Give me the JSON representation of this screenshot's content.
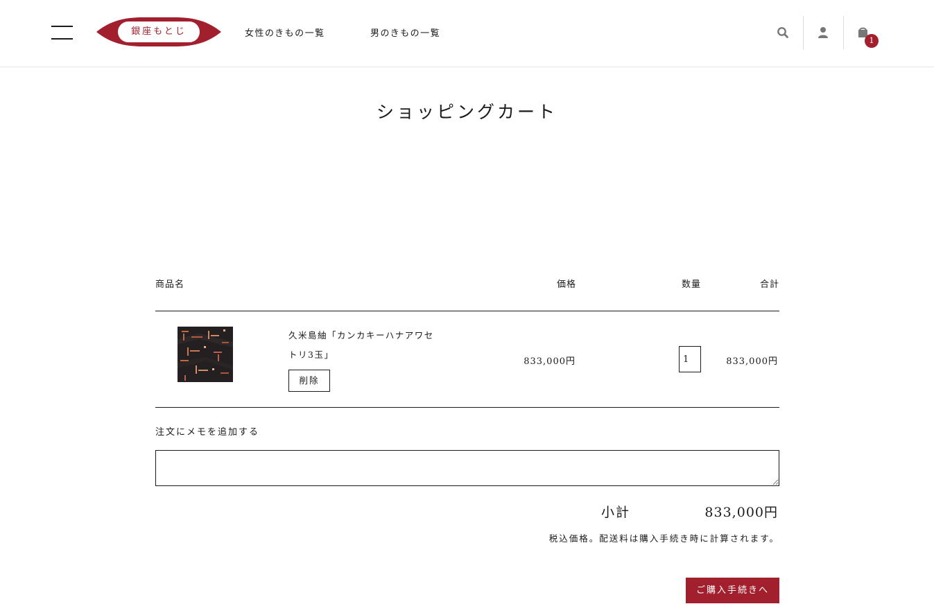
{
  "header": {
    "logo_text": "銀座もとじ",
    "nav": [
      {
        "label": "女性のきもの一覧"
      },
      {
        "label": "男のきもの一覧"
      }
    ],
    "cart_count": "1",
    "icons": [
      "hamburger-menu-icon",
      "search-icon",
      "user-icon",
      "shopping-bag-icon"
    ]
  },
  "page": {
    "title": "ショッピングカート"
  },
  "cart": {
    "columns": {
      "product": "商品名",
      "price": "価格",
      "quantity": "数量",
      "total": "合計"
    },
    "items": [
      {
        "name": "久米島紬「カンカキーハナアワセトリ3玉」",
        "price": "833,000円",
        "quantity": "1",
        "total": "833,000円",
        "remove_label": "削除"
      }
    ],
    "note_label": "注文にメモを追加する",
    "note_value": "",
    "subtotal_label": "小計",
    "subtotal_value": "833,000円",
    "tax_note": "税込価格。配送料は購入手続き時に計算されます。",
    "checkout_label": "ご購入手続きへ"
  },
  "colors": {
    "brand": "#a21f2d",
    "text": "#1a1a1a",
    "divider": "#e6e6e6"
  }
}
